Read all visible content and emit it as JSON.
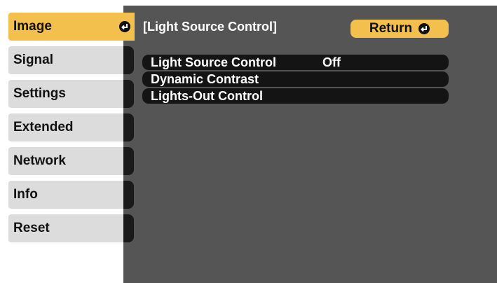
{
  "sidebar": {
    "items": [
      {
        "label": "Image",
        "active": true
      },
      {
        "label": "Signal"
      },
      {
        "label": "Settings"
      },
      {
        "label": "Extended"
      },
      {
        "label": "Network"
      },
      {
        "label": "Info"
      },
      {
        "label": "Reset"
      }
    ]
  },
  "header": {
    "title": "[Light Source Control]",
    "return_label": "Return"
  },
  "menu": {
    "rows": [
      {
        "label": "Light Source Control",
        "value": "Off"
      },
      {
        "label": "Dynamic Contrast",
        "value": ""
      },
      {
        "label": "Lights-Out Control",
        "value": ""
      }
    ]
  },
  "colors": {
    "accent": "#f3c04e",
    "panel": "#555555",
    "row": "#141414",
    "sidebar_item": "#dcdcdc"
  },
  "icons": {
    "enter": "enter-return-icon"
  }
}
